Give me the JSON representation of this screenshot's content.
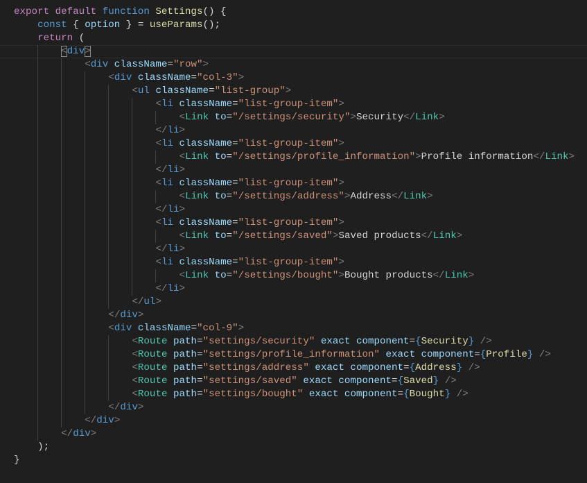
{
  "colors": {
    "background": "#1f1f1f",
    "keyword": "#c586c0",
    "string": "#ce9178",
    "component": "#4ec9b0",
    "attribute": "#9cdcfe"
  },
  "lines": [
    {
      "indent": 0,
      "tokens": [
        [
          "k",
          "export default "
        ],
        [
          "s",
          "function "
        ],
        [
          "f",
          "Settings"
        ],
        [
          "p",
          "() {"
        ]
      ]
    },
    {
      "indent": 1,
      "tokens": [
        [
          "s",
          "const "
        ],
        [
          "p",
          "{ "
        ],
        [
          "v",
          "option"
        ],
        [
          "p",
          " } = "
        ],
        [
          "f",
          "useParams"
        ],
        [
          "p",
          "();"
        ]
      ]
    },
    {
      "indent": 1,
      "tokens": [
        [
          "k",
          "return "
        ],
        [
          "p",
          "("
        ]
      ]
    },
    {
      "indent": 2,
      "current": true,
      "tokens": [
        [
          "t m",
          "<"
        ],
        [
          "n",
          "div"
        ],
        [
          "t m",
          ">"
        ]
      ]
    },
    {
      "indent": 3,
      "tokens": [
        [
          "t",
          "<"
        ],
        [
          "n",
          "div"
        ],
        [
          "a",
          " className"
        ],
        [
          "p",
          "="
        ],
        [
          "st",
          "\"row\""
        ],
        [
          "t",
          ">"
        ]
      ]
    },
    {
      "indent": 4,
      "tokens": [
        [
          "t",
          "<"
        ],
        [
          "n",
          "div"
        ],
        [
          "a",
          " className"
        ],
        [
          "p",
          "="
        ],
        [
          "st",
          "\"col-3\""
        ],
        [
          "t",
          ">"
        ]
      ]
    },
    {
      "indent": 5,
      "tokens": [
        [
          "t",
          "<"
        ],
        [
          "n",
          "ul"
        ],
        [
          "a",
          " className"
        ],
        [
          "p",
          "="
        ],
        [
          "st",
          "\"list-group\""
        ],
        [
          "t",
          ">"
        ]
      ]
    },
    {
      "indent": 6,
      "tokens": [
        [
          "t",
          "<"
        ],
        [
          "n",
          "li"
        ],
        [
          "a",
          " className"
        ],
        [
          "p",
          "="
        ],
        [
          "st",
          "\"list-group-item\""
        ],
        [
          "t",
          ">"
        ]
      ]
    },
    {
      "indent": 7,
      "tokens": [
        [
          "t",
          "<"
        ],
        [
          "c",
          "Link"
        ],
        [
          "a",
          " to"
        ],
        [
          "p",
          "="
        ],
        [
          "st",
          "\"/settings/security\""
        ],
        [
          "t",
          ">"
        ],
        [
          "tx",
          "Security"
        ],
        [
          "t",
          "</"
        ],
        [
          "c",
          "Link"
        ],
        [
          "t",
          ">"
        ]
      ]
    },
    {
      "indent": 6,
      "tokens": [
        [
          "t",
          "</"
        ],
        [
          "n",
          "li"
        ],
        [
          "t",
          ">"
        ]
      ]
    },
    {
      "indent": 6,
      "tokens": [
        [
          "t",
          "<"
        ],
        [
          "n",
          "li"
        ],
        [
          "a",
          " className"
        ],
        [
          "p",
          "="
        ],
        [
          "st",
          "\"list-group-item\""
        ],
        [
          "t",
          ">"
        ]
      ]
    },
    {
      "indent": 7,
      "tokens": [
        [
          "t",
          "<"
        ],
        [
          "c",
          "Link"
        ],
        [
          "a",
          " to"
        ],
        [
          "p",
          "="
        ],
        [
          "st",
          "\"/settings/profile_information\""
        ],
        [
          "t",
          ">"
        ],
        [
          "tx",
          "Profile information"
        ],
        [
          "t",
          "</"
        ],
        [
          "c",
          "Link"
        ],
        [
          "t",
          ">"
        ]
      ]
    },
    {
      "indent": 6,
      "tokens": [
        [
          "t",
          "</"
        ],
        [
          "n",
          "li"
        ],
        [
          "t",
          ">"
        ]
      ]
    },
    {
      "indent": 6,
      "tokens": [
        [
          "t",
          "<"
        ],
        [
          "n",
          "li"
        ],
        [
          "a",
          " className"
        ],
        [
          "p",
          "="
        ],
        [
          "st",
          "\"list-group-item\""
        ],
        [
          "t",
          ">"
        ]
      ]
    },
    {
      "indent": 7,
      "tokens": [
        [
          "t",
          "<"
        ],
        [
          "c",
          "Link"
        ],
        [
          "a",
          " to"
        ],
        [
          "p",
          "="
        ],
        [
          "st",
          "\"/settings/address\""
        ],
        [
          "t",
          ">"
        ],
        [
          "tx",
          "Address"
        ],
        [
          "t",
          "</"
        ],
        [
          "c",
          "Link"
        ],
        [
          "t",
          ">"
        ]
      ]
    },
    {
      "indent": 6,
      "tokens": [
        [
          "t",
          "</"
        ],
        [
          "n",
          "li"
        ],
        [
          "t",
          ">"
        ]
      ]
    },
    {
      "indent": 6,
      "tokens": [
        [
          "t",
          "<"
        ],
        [
          "n",
          "li"
        ],
        [
          "a",
          " className"
        ],
        [
          "p",
          "="
        ],
        [
          "st",
          "\"list-group-item\""
        ],
        [
          "t",
          ">"
        ]
      ]
    },
    {
      "indent": 7,
      "tokens": [
        [
          "t",
          "<"
        ],
        [
          "c",
          "Link"
        ],
        [
          "a",
          " to"
        ],
        [
          "p",
          "="
        ],
        [
          "st",
          "\"/settings/saved\""
        ],
        [
          "t",
          ">"
        ],
        [
          "tx",
          "Saved products"
        ],
        [
          "t",
          "</"
        ],
        [
          "c",
          "Link"
        ],
        [
          "t",
          ">"
        ]
      ]
    },
    {
      "indent": 6,
      "tokens": [
        [
          "t",
          "</"
        ],
        [
          "n",
          "li"
        ],
        [
          "t",
          ">"
        ]
      ]
    },
    {
      "indent": 6,
      "tokens": [
        [
          "t",
          "<"
        ],
        [
          "n",
          "li"
        ],
        [
          "a",
          " className"
        ],
        [
          "p",
          "="
        ],
        [
          "st",
          "\"list-group-item\""
        ],
        [
          "t",
          ">"
        ]
      ]
    },
    {
      "indent": 7,
      "tokens": [
        [
          "t",
          "<"
        ],
        [
          "c",
          "Link"
        ],
        [
          "a",
          " to"
        ],
        [
          "p",
          "="
        ],
        [
          "st",
          "\"/settings/bought\""
        ],
        [
          "t",
          ">"
        ],
        [
          "tx",
          "Bought products"
        ],
        [
          "t",
          "</"
        ],
        [
          "c",
          "Link"
        ],
        [
          "t",
          ">"
        ]
      ]
    },
    {
      "indent": 6,
      "tokens": [
        [
          "t",
          "</"
        ],
        [
          "n",
          "li"
        ],
        [
          "t",
          ">"
        ]
      ]
    },
    {
      "indent": 5,
      "tokens": [
        [
          "t",
          "</"
        ],
        [
          "n",
          "ul"
        ],
        [
          "t",
          ">"
        ]
      ]
    },
    {
      "indent": 4,
      "tokens": [
        [
          "t",
          "</"
        ],
        [
          "n",
          "div"
        ],
        [
          "t",
          ">"
        ]
      ]
    },
    {
      "indent": 4,
      "tokens": [
        [
          "t",
          "<"
        ],
        [
          "n",
          "div"
        ],
        [
          "a",
          " className"
        ],
        [
          "p",
          "="
        ],
        [
          "st",
          "\"col-9\""
        ],
        [
          "t",
          ">"
        ]
      ]
    },
    {
      "indent": 5,
      "tokens": [
        [
          "t",
          "<"
        ],
        [
          "c",
          "Route"
        ],
        [
          "a",
          " path"
        ],
        [
          "p",
          "="
        ],
        [
          "st",
          "\"settings/security\""
        ],
        [
          "a",
          " exact component"
        ],
        [
          "p",
          "="
        ],
        [
          "b",
          "{"
        ],
        [
          "f",
          "Security"
        ],
        [
          "b",
          "}"
        ],
        [
          "p",
          " "
        ],
        [
          "t",
          "/>"
        ]
      ]
    },
    {
      "indent": 5,
      "tokens": [
        [
          "t",
          "<"
        ],
        [
          "c",
          "Route"
        ],
        [
          "a",
          " path"
        ],
        [
          "p",
          "="
        ],
        [
          "st",
          "\"settings/profile_information\""
        ],
        [
          "a",
          " exact component"
        ],
        [
          "p",
          "="
        ],
        [
          "b",
          "{"
        ],
        [
          "f",
          "Profile"
        ],
        [
          "b",
          "}"
        ],
        [
          "p",
          " "
        ],
        [
          "t",
          "/>"
        ]
      ]
    },
    {
      "indent": 5,
      "tokens": [
        [
          "t",
          "<"
        ],
        [
          "c",
          "Route"
        ],
        [
          "a",
          " path"
        ],
        [
          "p",
          "="
        ],
        [
          "st",
          "\"settings/address\""
        ],
        [
          "a",
          " exact component"
        ],
        [
          "p",
          "="
        ],
        [
          "b",
          "{"
        ],
        [
          "f",
          "Address"
        ],
        [
          "b",
          "}"
        ],
        [
          "p",
          " "
        ],
        [
          "t",
          "/>"
        ]
      ]
    },
    {
      "indent": 5,
      "tokens": [
        [
          "t",
          "<"
        ],
        [
          "c",
          "Route"
        ],
        [
          "a",
          " path"
        ],
        [
          "p",
          "="
        ],
        [
          "st",
          "\"settings/saved\""
        ],
        [
          "a",
          " exact component"
        ],
        [
          "p",
          "="
        ],
        [
          "b",
          "{"
        ],
        [
          "f",
          "Saved"
        ],
        [
          "b",
          "}"
        ],
        [
          "p",
          " "
        ],
        [
          "t",
          "/>"
        ]
      ]
    },
    {
      "indent": 5,
      "tokens": [
        [
          "t",
          "<"
        ],
        [
          "c",
          "Route"
        ],
        [
          "a",
          " path"
        ],
        [
          "p",
          "="
        ],
        [
          "st",
          "\"settings/bought\""
        ],
        [
          "a",
          " exact component"
        ],
        [
          "p",
          "="
        ],
        [
          "b",
          "{"
        ],
        [
          "f",
          "Bought"
        ],
        [
          "b",
          "}"
        ],
        [
          "p",
          " "
        ],
        [
          "t",
          "/>"
        ]
      ]
    },
    {
      "indent": 4,
      "tokens": [
        [
          "t",
          "</"
        ],
        [
          "n",
          "div"
        ],
        [
          "t",
          ">"
        ]
      ]
    },
    {
      "indent": 3,
      "tokens": [
        [
          "t",
          "</"
        ],
        [
          "n",
          "div"
        ],
        [
          "t",
          ">"
        ]
      ]
    },
    {
      "indent": 2,
      "tokens": [
        [
          "t",
          "</"
        ],
        [
          "n",
          "div"
        ],
        [
          "t",
          ">"
        ]
      ]
    },
    {
      "indent": 1,
      "tokens": [
        [
          "p",
          ");"
        ]
      ]
    },
    {
      "indent": 0,
      "tokens": [
        [
          "p",
          "}"
        ]
      ]
    }
  ]
}
